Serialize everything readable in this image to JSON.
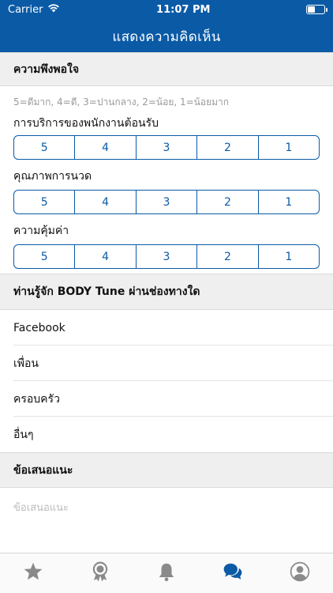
{
  "status_bar": {
    "carrier": "Carrier",
    "time": "11:07 PM",
    "battery_level": 0.5
  },
  "header": {
    "title": "แสดงความคิดเห็น"
  },
  "satisfaction": {
    "title": "ความพึงพอใจ",
    "hint": "5=ดีมาก, 4=ดี, 3=ปานกลาง, 2=น้อย, 1=น้อยมาก",
    "ratings": [
      {
        "label": "การบริการของพนักงานต้อนรับ",
        "options": [
          "5",
          "4",
          "3",
          "2",
          "1"
        ]
      },
      {
        "label": "คุณภาพการนวด",
        "options": [
          "5",
          "4",
          "3",
          "2",
          "1"
        ]
      },
      {
        "label": "ความคุ้มค่า",
        "options": [
          "5",
          "4",
          "3",
          "2",
          "1"
        ]
      }
    ]
  },
  "channels": {
    "title": "ท่านรู้จัก BODY Tune ผ่านช่องทางใด",
    "items": [
      "Facebook",
      "เพื่อน",
      "ครอบครัว",
      "อื่นๆ"
    ]
  },
  "suggestion": {
    "title": "ข้อเสนอแนะ",
    "placeholder": "ข้อเสนอแนะ"
  },
  "tabbar": {
    "accent": "#0b5aa6",
    "inactive": "#8a8a8a",
    "tabs": [
      "star-icon",
      "award-icon",
      "bell-icon",
      "chat-icon",
      "profile-icon"
    ],
    "active_tab": "chat-icon"
  }
}
